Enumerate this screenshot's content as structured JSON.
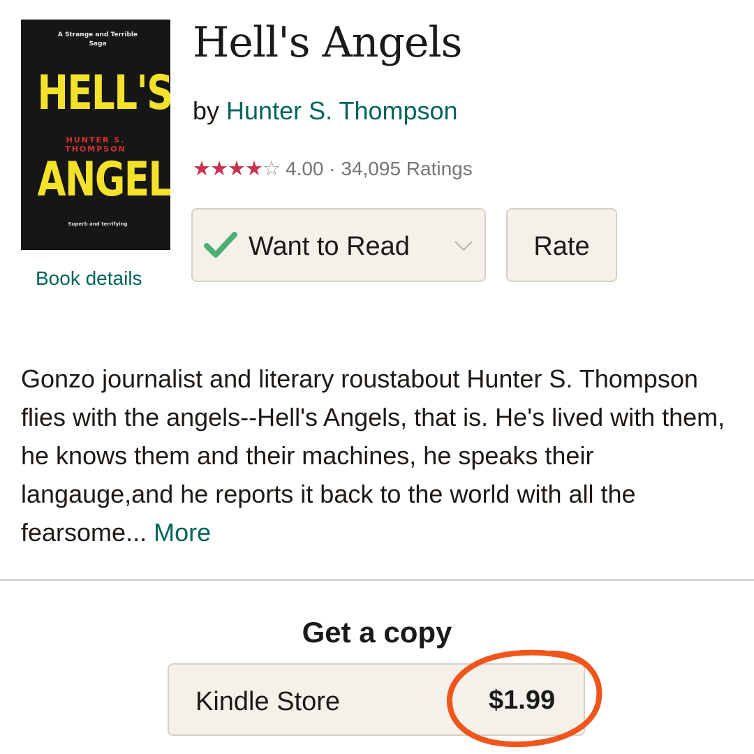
{
  "book": {
    "cover": {
      "tagline": "A Strange and Terrible Saga",
      "title_line1": "HELL'S",
      "title_line2": "ANGELS",
      "author_line1": "HUNTER S.",
      "author_line2": "THOMPSON",
      "blurb": "Superb and terrifying"
    },
    "details_link": "Book details",
    "title": "Hell's Angels",
    "by_label": "by",
    "author": "Hunter S. Thompson",
    "rating": {
      "stars_filled": 4,
      "stars_total": 5,
      "text": "4.00 · 34,095 Ratings"
    }
  },
  "actions": {
    "want_to_read_label": "Want to Read",
    "rate_label": "Rate"
  },
  "description": {
    "text": "Gonzo journalist and literary roustabout Hunter S. Thompson flies with the angels--Hell's Angels, that is. He's lived with them, he knows them and their machines, he speaks their langauge,and he reports it back to the world with all the fearsome...",
    "more_label": "More"
  },
  "get_copy": {
    "heading": "Get a copy",
    "store_label": "Kindle Store",
    "price": "$1.99"
  },
  "colors": {
    "link": "#00635d",
    "star": "#c8324f",
    "check": "#4cae72",
    "annotation": "#f0561c"
  },
  "icons": {
    "check": "check-icon",
    "dropdown": "chevron-down-icon",
    "star": "star-icon"
  }
}
